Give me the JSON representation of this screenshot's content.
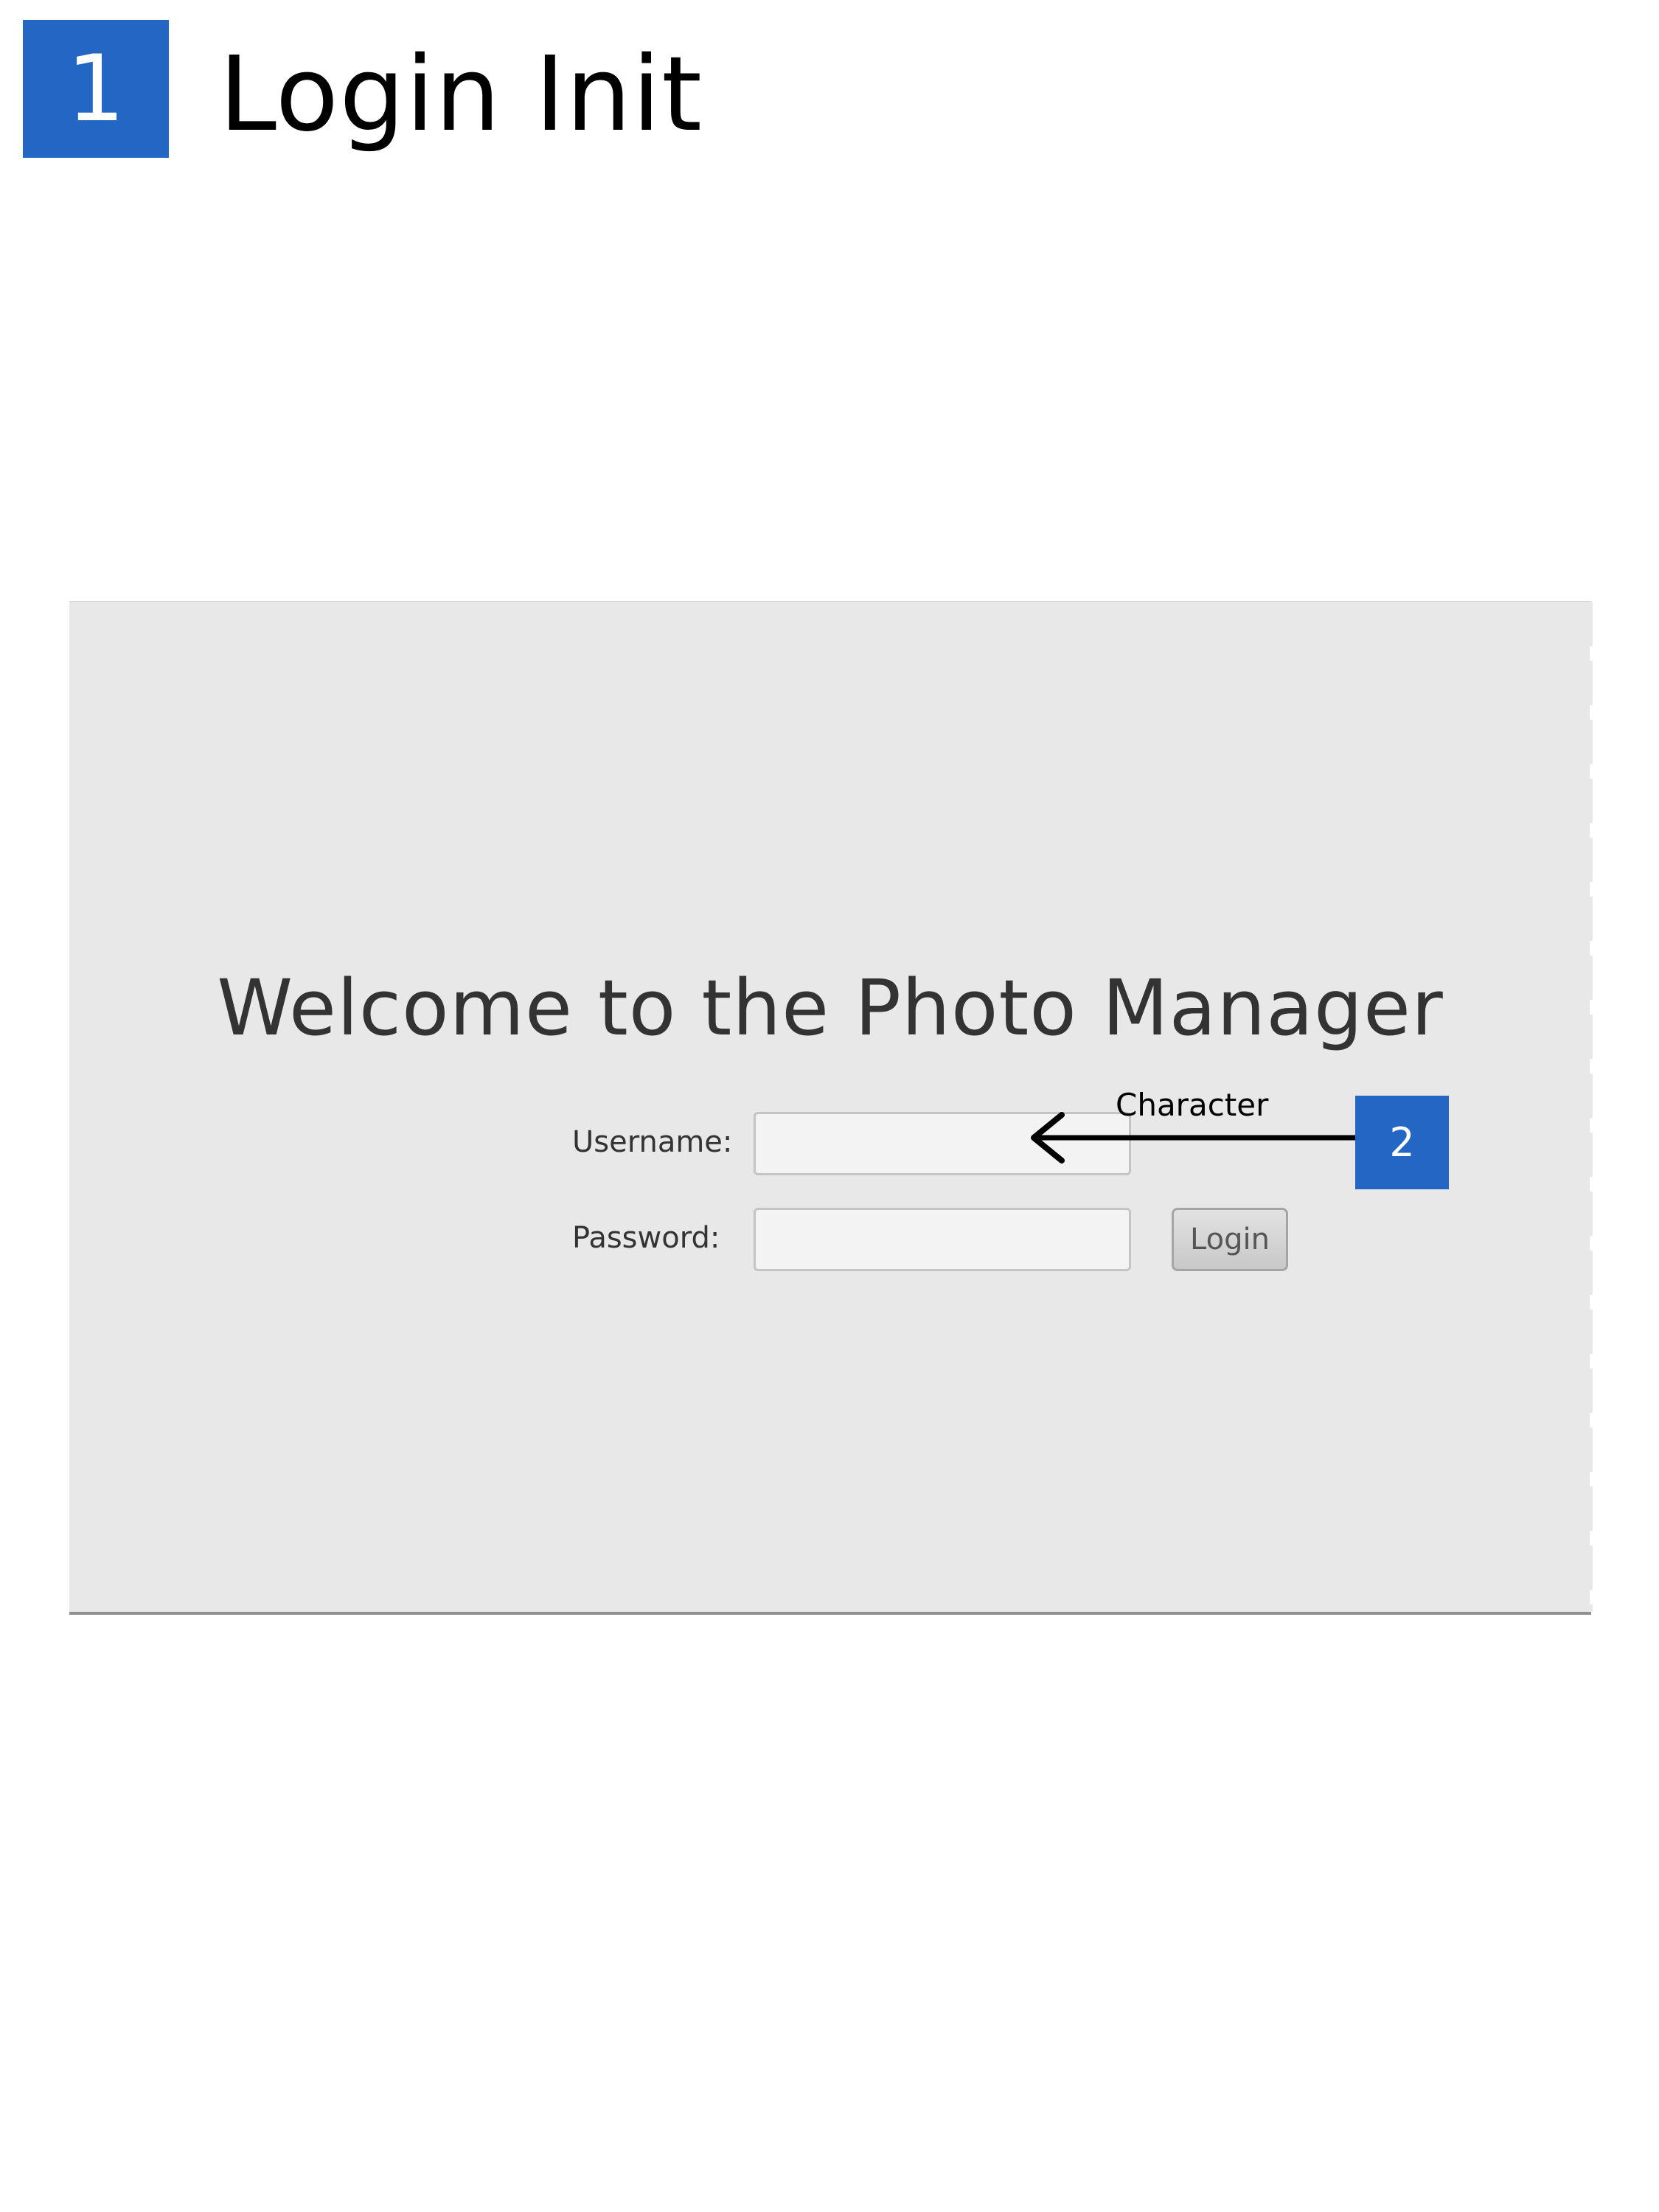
{
  "header": {
    "step_number": "1",
    "title": "Login Init"
  },
  "login_window": {
    "welcome_title": "Welcome to the Photo Manager",
    "username": {
      "label": "Username:",
      "value": "",
      "placeholder": ""
    },
    "password": {
      "label": "Password:",
      "value": "",
      "placeholder": ""
    },
    "login_button_label": "Login"
  },
  "annotation": {
    "label": "Character",
    "callout_number": "2",
    "accent_color": "#2466c4"
  }
}
